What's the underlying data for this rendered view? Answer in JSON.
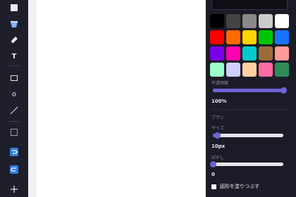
{
  "toolbar": {
    "tools": [
      "rectangle-fill-icon",
      "bucket-icon",
      "pencil-icon",
      "text-icon",
      "rectangle-icon",
      "circle-icon",
      "line-icon",
      "frame-icon",
      "undo-icon",
      "redo-icon",
      "plus-icon"
    ],
    "text_tool_glyph": "T"
  },
  "colors": {
    "accent": "#6f63d8",
    "swatches": [
      "#000000",
      "#444444",
      "#888888",
      "#cccccc",
      "#ffffff",
      "#ff0000",
      "#ff6a00",
      "#ffd400",
      "#00c800",
      "#1a73ff",
      "#7a00e6",
      "#ff00b0",
      "#00cccc",
      "#9c6b3a",
      "#ff9a9a",
      "#9affc8",
      "#cfcfff",
      "#ffd1a3",
      "#ff6ba3",
      "#2e8b57"
    ]
  },
  "panel": {
    "opacity_label": "不透明度",
    "opacity_value": "100%",
    "opacity_level": 1.0,
    "brush_section": "ブラシ",
    "size_label": "サイズ",
    "size_value": "10px",
    "size_level": 0.06,
    "blur_label": "ぼかし",
    "blur_value": "0",
    "blur_level": 0.0,
    "fill_shape_label": "図形を塗りつぶす",
    "fill_shape_checked": false
  }
}
